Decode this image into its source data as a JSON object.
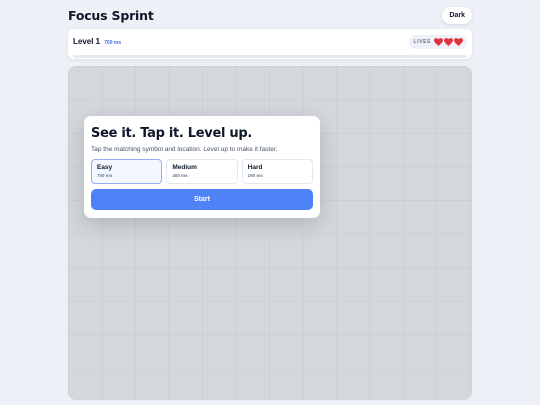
{
  "header": {
    "title": "Focus Sprint",
    "theme_button_label": "Dark"
  },
  "status": {
    "level_label": "Level 1",
    "speed_label": "700 ms",
    "lives_label": "LIVES",
    "lives_count": 3,
    "progress_fraction": 0.0
  },
  "colors": {
    "accent": "#4f82f7",
    "heart": "#e0323d",
    "board_overlay": "#d4d8dc"
  },
  "modal": {
    "title": "See it. Tap it. Level up.",
    "subtitle": "Tap the matching symbol and location. Level up to make it faster.",
    "difficulties": [
      {
        "name": "Easy",
        "speed": "700 ms",
        "selected": true
      },
      {
        "name": "Medium",
        "speed": "400 ms",
        "selected": false
      },
      {
        "name": "Hard",
        "speed": "150 ms",
        "selected": false
      }
    ],
    "start_label": "Start"
  }
}
